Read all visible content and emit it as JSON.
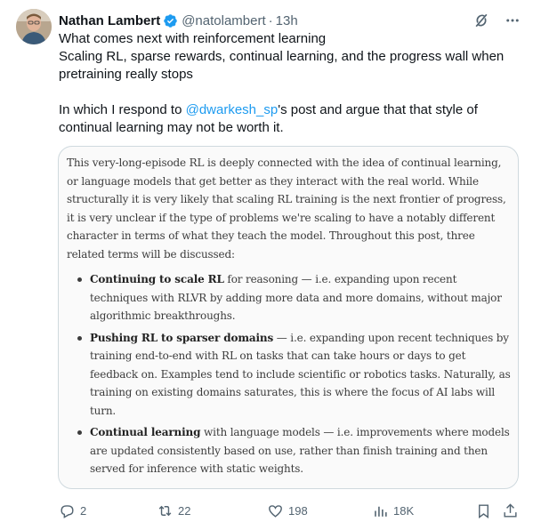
{
  "author": {
    "name": "Nathan Lambert",
    "handle": "@natolambert",
    "separator": "·",
    "time": "13h"
  },
  "tweet": {
    "line1": "What comes next with reinforcement learning",
    "line2": "Scaling RL, sparse rewards, continual learning, and the progress wall when pretraining really stops",
    "line3_before": "In which I respond to ",
    "mention": "@dwarkesh_sp",
    "line3_after": "'s post and argue that that style of continual learning may not be worth it."
  },
  "card": {
    "intro": "This very-long-episode RL is deeply connected with the idea of continual learning, or language models that get better as they interact with the real world. While structurally it is very likely that scaling RL training is the next frontier of progress, it is very unclear if the type of problems we're scaling to have a notably different character in terms of what they teach the model. Throughout this post, three related terms will be discussed:",
    "bullets": [
      {
        "bold": "Continuing to scale RL",
        "text": " for reasoning — i.e. expanding upon recent techniques with RLVR by adding more data and more domains, without major algorithmic breakthroughs."
      },
      {
        "bold": "Pushing RL to sparser domains",
        "text": " — i.e. expanding upon recent techniques by training end-to-end with RL on tasks that can take hours or days to get feedback on. Examples tend to include scientific or robotics tasks. Naturally, as training on existing domains saturates, this is where the focus of AI labs will turn."
      },
      {
        "bold": "Continual learning",
        "text": " with language models — i.e. improvements where models are updated consistently based on use, rather than finish training and then served for inference with static weights."
      }
    ]
  },
  "actions": {
    "replies": "2",
    "reposts": "22",
    "likes": "198",
    "views": "18K"
  },
  "colors": {
    "accent": "#1d9bf0",
    "muted": "#536471",
    "border": "#cfd9de"
  }
}
